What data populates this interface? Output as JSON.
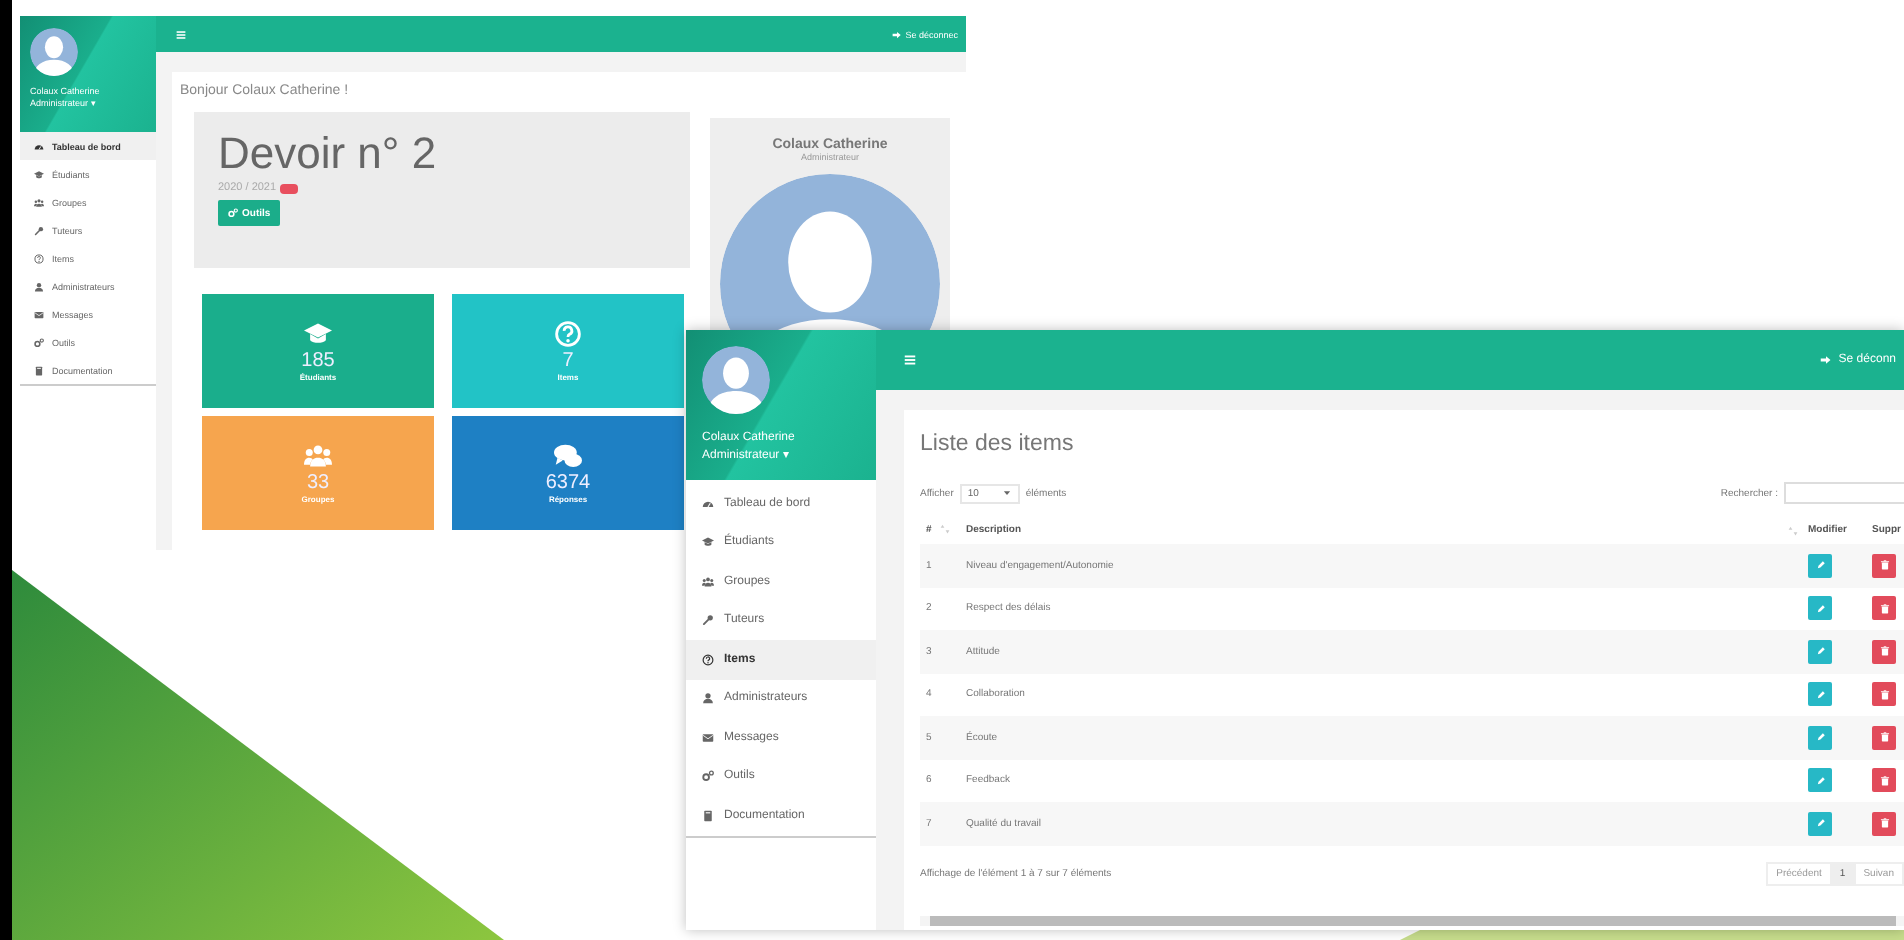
{
  "dashboard_window": {
    "sidebar": {
      "user_name": "Colaux Catherine",
      "user_role": "Administrateur ▾",
      "items": [
        {
          "label": "Tableau de bord",
          "selected": true
        },
        {
          "label": "Étudiants",
          "selected": false
        },
        {
          "label": "Groupes",
          "selected": false
        },
        {
          "label": "Tuteurs",
          "selected": false
        },
        {
          "label": "Items",
          "selected": false
        },
        {
          "label": "Administrateurs",
          "selected": false
        },
        {
          "label": "Messages",
          "selected": false
        },
        {
          "label": "Outils",
          "selected": false
        },
        {
          "label": "Documentation",
          "selected": false
        }
      ]
    },
    "logout": "Se déconnec",
    "greeting": "Bonjour Colaux Catherine !",
    "assignment": {
      "title": "Devoir n° 2",
      "year": "2020 / 2021"
    },
    "tools_button": "Outils",
    "tiles": [
      {
        "value": "185",
        "label": "Étudiants",
        "color": "#1aae8c"
      },
      {
        "value": "7",
        "label": "Items",
        "color": "#22c3c6"
      },
      {
        "value": "33",
        "label": "Groupes",
        "color": "#f6a54e"
      },
      {
        "value": "6374",
        "label": "Réponses",
        "color": "#1e80c4"
      }
    ],
    "profile": {
      "name": "Colaux Catherine",
      "role": "Administrateur"
    }
  },
  "items_window": {
    "sidebar": {
      "user_name": "Colaux Catherine",
      "user_role": "Administrateur ▾",
      "items": [
        {
          "label": "Tableau de bord",
          "selected": false
        },
        {
          "label": "Étudiants",
          "selected": false
        },
        {
          "label": "Groupes",
          "selected": false
        },
        {
          "label": "Tuteurs",
          "selected": false
        },
        {
          "label": "Items",
          "selected": true
        },
        {
          "label": "Administrateurs",
          "selected": false
        },
        {
          "label": "Messages",
          "selected": false
        },
        {
          "label": "Outils",
          "selected": false
        },
        {
          "label": "Documentation",
          "selected": false
        }
      ]
    },
    "logout": "Se déconn",
    "title": "Liste des items",
    "length_control": {
      "before": "Afficher",
      "value": "10",
      "after": "éléments"
    },
    "search_label": "Rechercher :",
    "table": {
      "columns": [
        "#",
        "Description",
        "Modifier",
        "Suppr"
      ],
      "rows": [
        {
          "number": "1",
          "description": "Niveau d'engagement/Autonomie"
        },
        {
          "number": "2",
          "description": "Respect des délais"
        },
        {
          "number": "3",
          "description": "Attitude"
        },
        {
          "number": "4",
          "description": "Collaboration"
        },
        {
          "number": "5",
          "description": "Écoute"
        },
        {
          "number": "6",
          "description": "Feedback"
        },
        {
          "number": "7",
          "description": "Qualité du travail"
        }
      ]
    },
    "info": "Affichage de l'élément 1 à 7 sur 7 éléments",
    "pagination": {
      "previous": "Précédent",
      "pages": [
        {
          "label": "1",
          "selected": true
        }
      ],
      "next": "Suivan"
    }
  }
}
